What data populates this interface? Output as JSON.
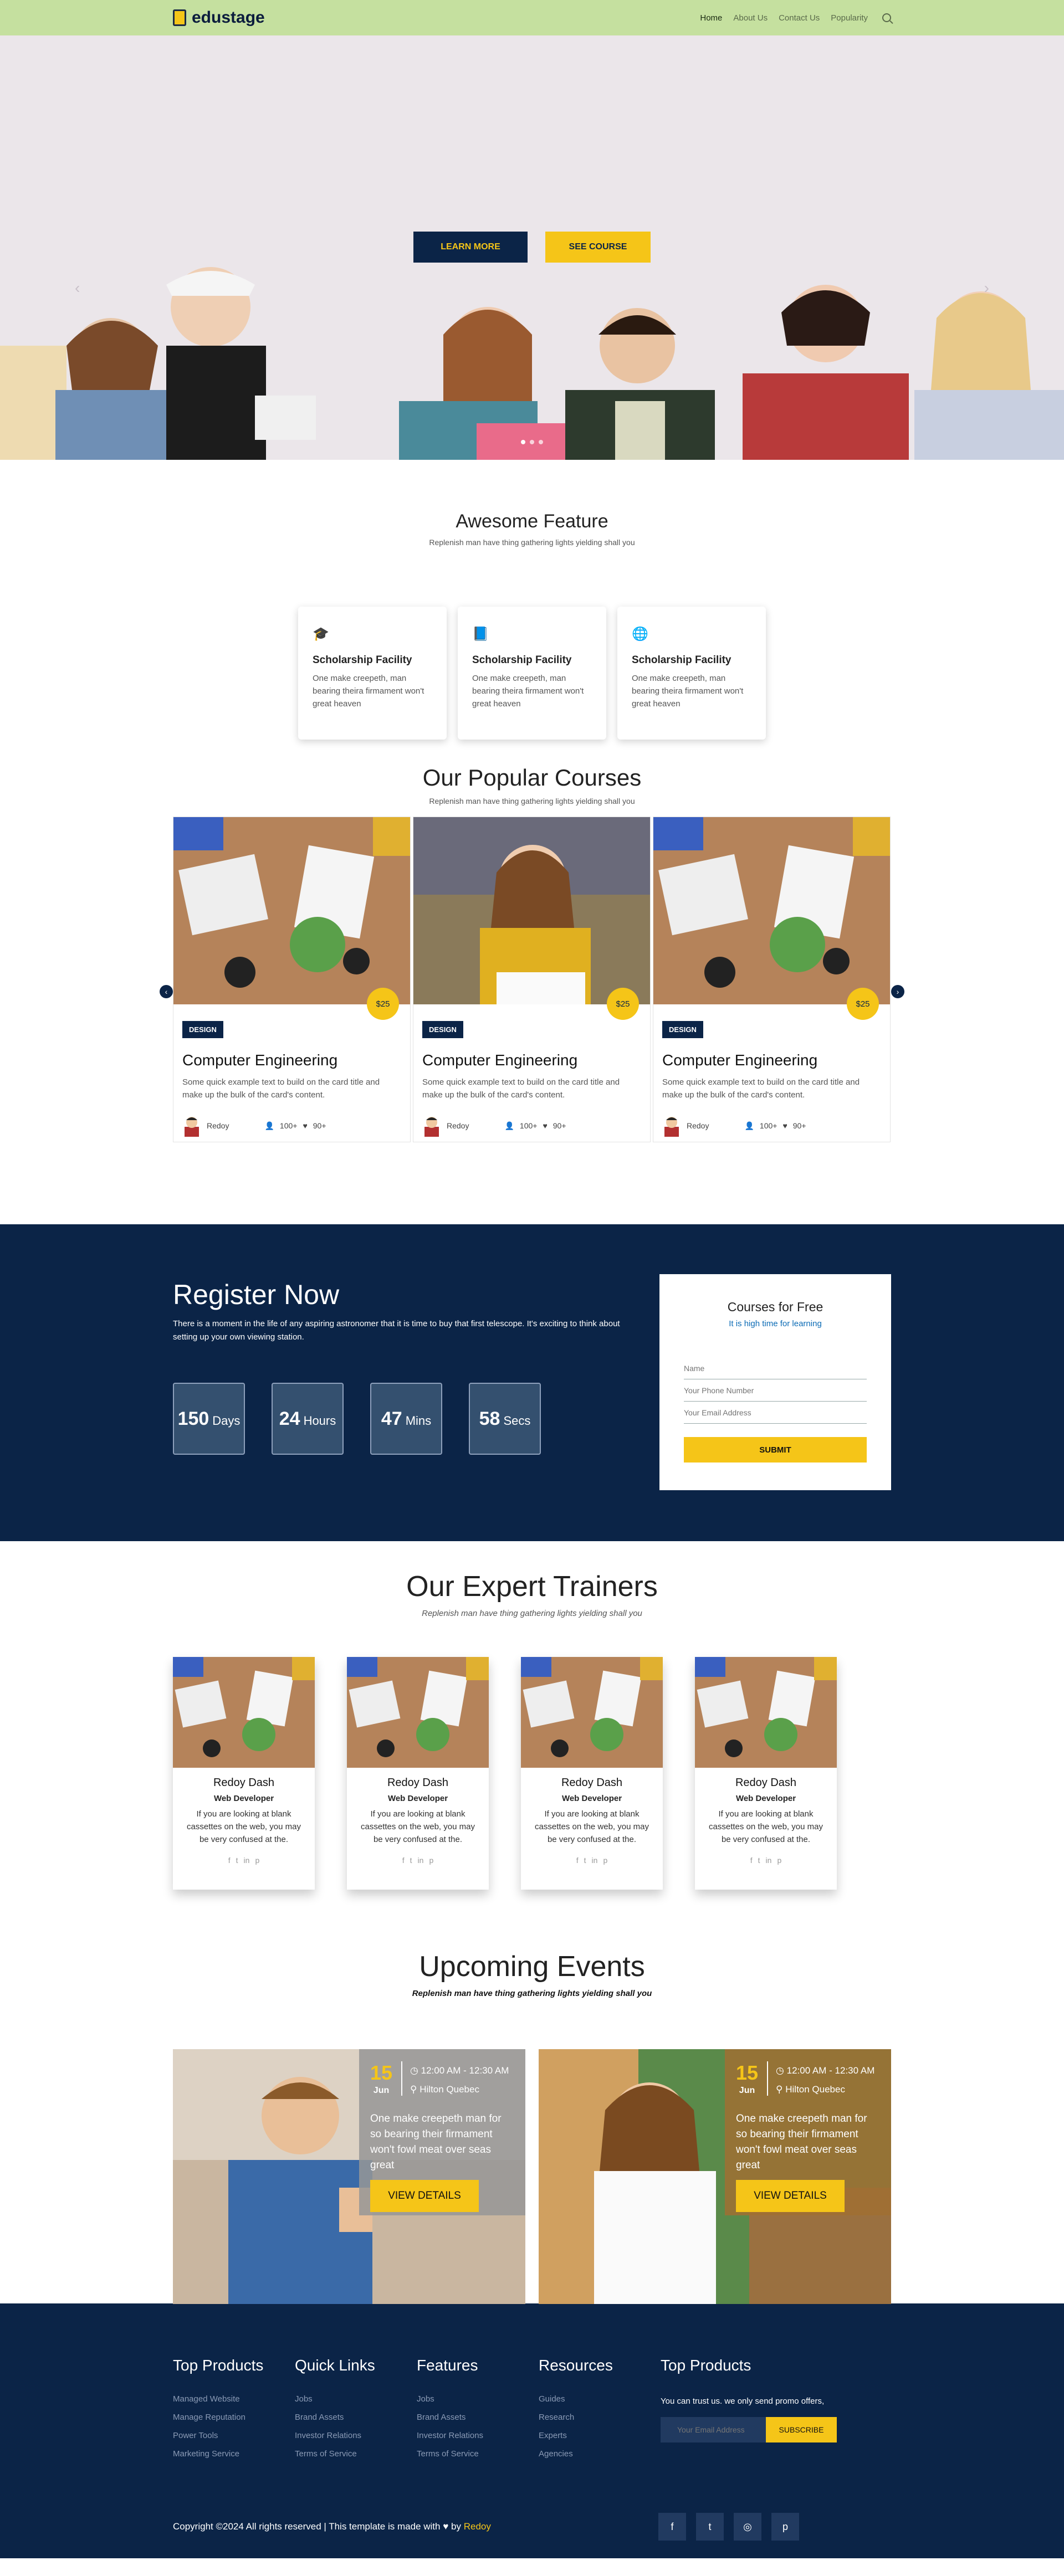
{
  "nav": {
    "brand": "edustage",
    "links": [
      "Home",
      "About Us",
      "Contact Us",
      "Popularity"
    ],
    "search_icon": "search-icon"
  },
  "hero": {
    "learn_more": "LEARN MORE",
    "see_course": "SEE COURSE",
    "prev": "‹",
    "next": "›"
  },
  "features": {
    "title": "Awesome Feature",
    "subtitle": "Replenish man have thing gathering lights yielding shall you",
    "items": [
      {
        "icon": "graduation-cap-icon",
        "title": "Scholarship Facility",
        "text": "One make creepeth, man bearing theira firmament won't great heaven"
      },
      {
        "icon": "book-icon",
        "title": "Scholarship Facility",
        "text": "One make creepeth, man bearing theira firmament won't great heaven"
      },
      {
        "icon": "globe-icon",
        "title": "Scholarship Facility",
        "text": "One make creepeth, man bearing theira firmament won't great heaven"
      }
    ]
  },
  "courses": {
    "title": "Our Popular Courses",
    "subtitle": "Replenish man have thing gathering lights yielding shall you",
    "items": [
      {
        "price": "$25",
        "tag": "DESIGN",
        "title": "Computer Engineering",
        "text": "Some quick example text to build on the card title and make up the bulk of the card's content.",
        "author": "Redoy",
        "students": "100+",
        "likes": "90+"
      },
      {
        "price": "$25",
        "tag": "DESIGN",
        "title": "Computer Engineering",
        "text": "Some quick example text to build on the card title and make up the bulk of the card's content.",
        "author": "Redoy",
        "students": "100+",
        "likes": "90+"
      },
      {
        "price": "$25",
        "tag": "DESIGN",
        "title": "Computer Engineering",
        "text": "Some quick example text to build on the card title and make up the bulk of the card's content.",
        "author": "Redoy",
        "students": "100+",
        "likes": "90+"
      }
    ]
  },
  "register": {
    "title": "Register Now",
    "text": "There is a moment in the life of any aspiring astronomer that it is time to buy that first telescope. It's exciting to think about setting up your own viewing station.",
    "countdown": [
      {
        "num": "150",
        "label": "Days"
      },
      {
        "num": "24",
        "label": "Hours"
      },
      {
        "num": "47",
        "label": "Mins"
      },
      {
        "num": "58",
        "label": "Secs"
      }
    ],
    "form": {
      "title": "Courses for Free",
      "subtitle": "It is high time for learning",
      "name_ph": "Name",
      "phone_ph": "Your Phone Number",
      "email_ph": "Your Email Address",
      "submit": "SUBMIT"
    }
  },
  "trainers": {
    "title": "Our Expert Trainers",
    "subtitle": "Replenish man have thing gathering lights yielding shall you",
    "items": [
      {
        "name": "Redoy Dash",
        "role": "Web Developer",
        "text": "If you are looking at blank cassettes on the web, you may be very confused at the."
      },
      {
        "name": "Redoy Dash",
        "role": "Web Developer",
        "text": "If you are looking at blank cassettes on the web, you may be very confused at the."
      },
      {
        "name": "Redoy Dash",
        "role": "Web Developer",
        "text": "If you are looking at blank cassettes on the web, you may be very confused at the."
      },
      {
        "name": "Redoy Dash",
        "role": "Web Developer",
        "text": "If you are looking at blank cassettes on the web, you may be very confused at the."
      }
    ]
  },
  "events": {
    "title": "Upcoming Events",
    "subtitle": "Replenish man have thing gathering lights yielding shall you",
    "items": [
      {
        "day": "15",
        "month": "Jun",
        "time": "12:00 AM - 12:30 AM",
        "place": "Hilton Quebec",
        "text": "One make creepeth man for so bearing their firmament won't fowl meat over seas great",
        "button": "VIEW DETAILS"
      },
      {
        "day": "15",
        "month": "Jun",
        "time": "12:00 AM - 12:30 AM",
        "place": "Hilton Quebec",
        "text": "One make creepeth man for so bearing their firmament won't fowl meat over seas great",
        "button": "VIEW DETAILS"
      }
    ]
  },
  "footer": {
    "cols": [
      {
        "title": "Top Products",
        "items": [
          "Managed Website",
          "Manage Reputation",
          "Power Tools",
          "Marketing Service"
        ]
      },
      {
        "title": "Quick Links",
        "items": [
          "Jobs",
          "Brand Assets",
          "Investor Relations",
          "Terms of Service"
        ]
      },
      {
        "title": "Features",
        "items": [
          "Jobs",
          "Brand Assets",
          "Investor Relations",
          "Terms of Service"
        ]
      },
      {
        "title": "Resources",
        "items": [
          "Guides",
          "Research",
          "Experts",
          "Agencies"
        ]
      }
    ],
    "news_title": "Top Products",
    "news_text": "You can trust us. we only send promo offers,",
    "news_ph": "Your Email Address",
    "news_btn": "SUBSCRIBE",
    "copy_pre": "Copyright ©2024 All rights reserved | This template is made with",
    "copy_by": "by",
    "copy_author": "Redoy"
  },
  "colors": {
    "navy": "#0b2447",
    "yellow": "#f5c518",
    "nav_green": "#c5e09f"
  }
}
